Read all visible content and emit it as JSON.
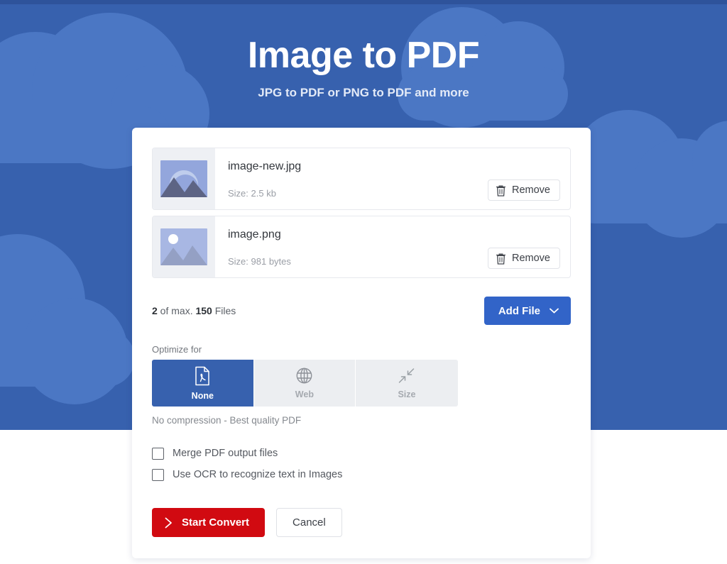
{
  "hero": {
    "title": "Image to PDF",
    "subtitle": "JPG to PDF or PNG to PDF and more",
    "background_color": "#3761ae",
    "cloud_color": "#4b77c4"
  },
  "files": [
    {
      "name": "image-new.jpg",
      "size_label": "Size: 2.5 kb",
      "remove_label": "Remove",
      "thumbnail": "image-thumbnail-mountains-arc"
    },
    {
      "name": "image.png",
      "size_label": "Size: 981 bytes",
      "remove_label": "Remove",
      "thumbnail": "image-thumbnail-mountains-sun"
    }
  ],
  "counter": {
    "count": "2",
    "middle": " of max. ",
    "max": "150",
    "suffix": " Files"
  },
  "add_file": {
    "label": "Add File",
    "icon": "chevron-down-icon",
    "color": "#3264c8"
  },
  "optimize": {
    "label": "Optimize for",
    "hint": "No compression - Best quality PDF",
    "selected": "None",
    "options": [
      {
        "label": "None",
        "icon": "pdf-file-icon",
        "selected": true
      },
      {
        "label": "Web",
        "icon": "globe-icon",
        "selected": false
      },
      {
        "label": "Size",
        "icon": "compress-arrows-icon",
        "selected": false
      }
    ]
  },
  "checkboxes": [
    {
      "label": "Merge PDF output files",
      "checked": false
    },
    {
      "label": "Use OCR to recognize text in Images",
      "checked": false
    }
  ],
  "actions": {
    "convert_label": "Start Convert",
    "convert_icon": "chevron-right-icon",
    "convert_color": "#d10a11",
    "cancel_label": "Cancel"
  }
}
